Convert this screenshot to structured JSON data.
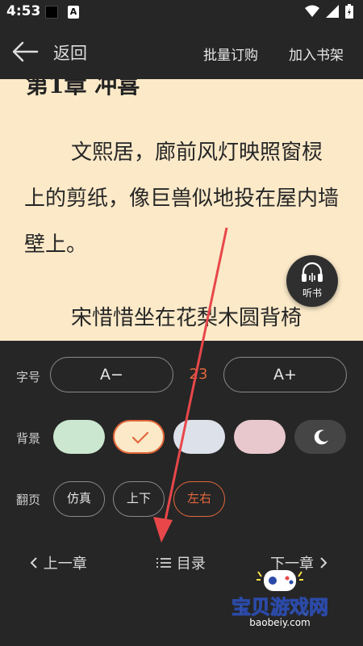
{
  "status_bar": {
    "time": "4:53",
    "notification_letter": "A"
  },
  "top_bar": {
    "back_label": "返回",
    "batch_label": "批量订购",
    "shelf_label": "加入书架"
  },
  "reader": {
    "chapter_title": "第1章 冲喜",
    "paragraph1": "文熙居，廊前风灯映照窗棂上的剪纸，像巨兽似地投在屋内墙壁上。",
    "paragraph2": "宋惜惜坐在花梨木圆背椅",
    "listen_label": "听书"
  },
  "settings": {
    "font_label": "字号",
    "font_decrease": "A−",
    "font_size": "23",
    "font_increase": "A+",
    "bg_label": "背景",
    "backgrounds": [
      {
        "name": "green",
        "color": "#cbe7cf"
      },
      {
        "name": "cream",
        "color": "#fbe9c8",
        "selected": true
      },
      {
        "name": "gray",
        "color": "#dde1ea"
      },
      {
        "name": "pink",
        "color": "#e9c8cd"
      },
      {
        "name": "night",
        "color": "#454545"
      }
    ],
    "page_turn_label": "翻页",
    "page_turn_options": [
      "仿真",
      "上下",
      "左右"
    ],
    "page_turn_selected": "左右",
    "accent_color": "#e2673b"
  },
  "nav": {
    "prev": "上一章",
    "toc": "目录",
    "next": "下一章"
  },
  "watermark": {
    "text": "宝贝游戏网",
    "url": "baobeiy.com"
  }
}
